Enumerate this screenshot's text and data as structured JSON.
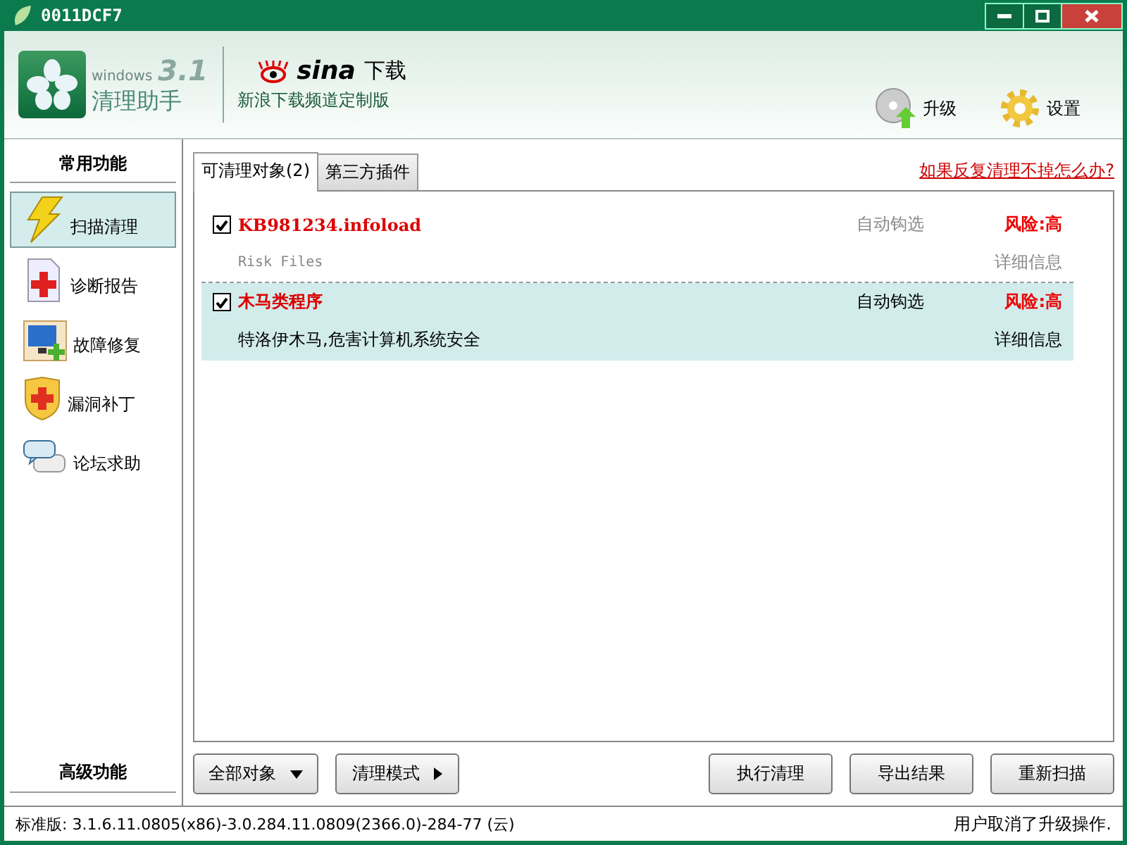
{
  "window": {
    "title": "0011DCF7"
  },
  "header": {
    "logo_small": "windows",
    "logo_version": "3.1",
    "logo_name": "清理助手",
    "partner_brand": "sina",
    "partner_label": "下载",
    "partner_caption": "新浪下载频道定制版",
    "actions": [
      {
        "label": "升级"
      },
      {
        "label": "设置"
      }
    ]
  },
  "sidebar": {
    "title": "常用功能",
    "items": [
      {
        "label": "扫描清理",
        "selected": true
      },
      {
        "label": "诊断报告",
        "selected": false
      },
      {
        "label": "故障修复",
        "selected": false
      },
      {
        "label": "漏洞补丁",
        "selected": false
      },
      {
        "label": "论坛求助",
        "selected": false
      }
    ],
    "footer": "高级功能"
  },
  "tabs": [
    {
      "label": "可清理对象(2)",
      "selected": true
    },
    {
      "label": "第三方插件",
      "selected": false
    }
  ],
  "help_link": "如果反复清理不掉怎么办?",
  "items": [
    {
      "name": "KB981234.infoload",
      "checked": true,
      "selected": false,
      "auto": "自动钩选",
      "risk": "风险:高",
      "description": "Risk Files",
      "details": "详细信息"
    },
    {
      "name": "木马类程序",
      "checked": true,
      "selected": true,
      "auto": "自动钩选",
      "risk": "风险:高",
      "description": "特洛伊木马,危害计算机系统安全",
      "details": "详细信息"
    }
  ],
  "left_buttons": [
    {
      "label": "全部对象",
      "kind": "dropdown"
    },
    {
      "label": "清理模式",
      "kind": "submenu"
    }
  ],
  "right_buttons": [
    {
      "label": "执行清理"
    },
    {
      "label": "导出结果"
    },
    {
      "label": "重新扫描"
    }
  ],
  "status_bar": {
    "version": "标准版: 3.1.6.11.0805(x86)-3.0.284.11.0809(2366.0)-284-77 (云)",
    "message": "用户取消了升级操作."
  }
}
